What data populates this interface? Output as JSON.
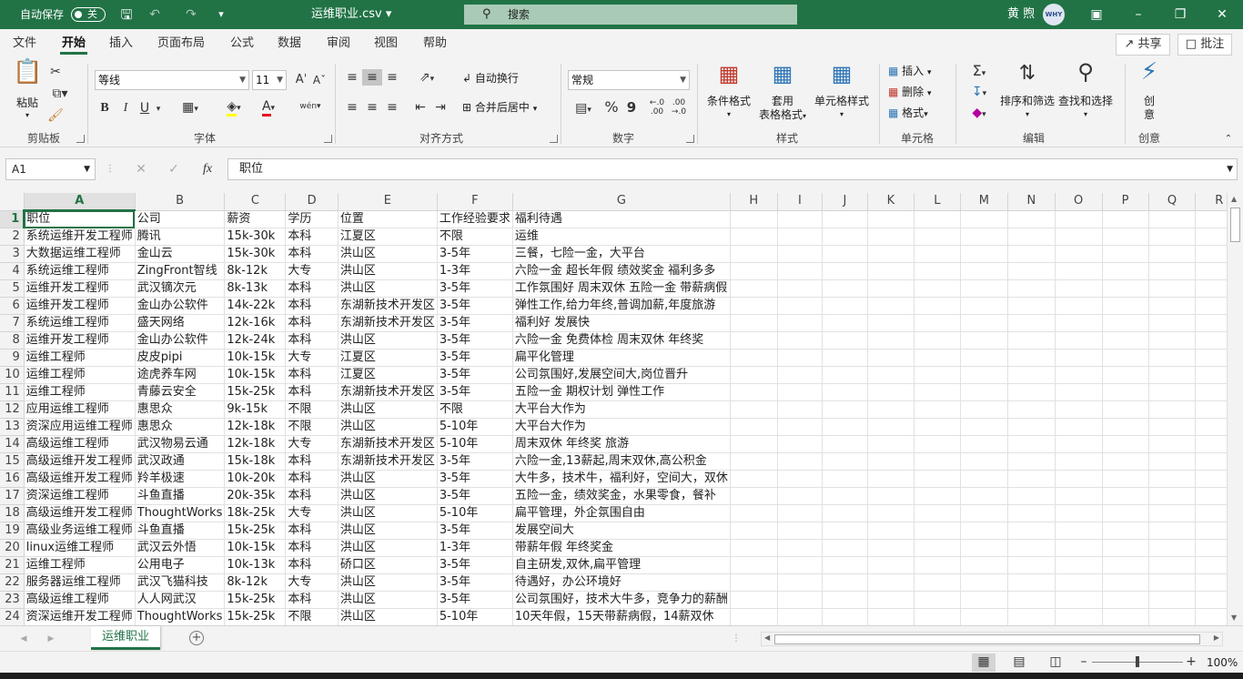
{
  "titlebar": {
    "autosave": "自动保存",
    "autosave_state": "关",
    "filename": "运维职业.csv",
    "search": "搜索",
    "user": "黄 煦",
    "avatar_text": "WHY"
  },
  "menu": {
    "tabs": [
      "文件",
      "开始",
      "插入",
      "页面布局",
      "公式",
      "数据",
      "审阅",
      "视图",
      "帮助"
    ],
    "share": "共享",
    "comment": "批注"
  },
  "ribbon": {
    "clipboard": {
      "label": "剪贴板",
      "paste": "粘贴"
    },
    "font": {
      "label": "字体",
      "name": "等线",
      "size": "11",
      "bold": "B",
      "italic": "I",
      "underline": "U",
      "phonetic": "wén"
    },
    "alignment": {
      "label": "对齐方式",
      "wrap": "自动换行",
      "merge": "合并后居中"
    },
    "number": {
      "label": "数字",
      "format": "常规",
      "percent": "%",
      "comma": "9"
    },
    "styles": {
      "label": "样式",
      "conditional": "条件格式",
      "table1": "套用",
      "table2": "表格格式",
      "cell": "单元格样式"
    },
    "cells": {
      "label": "单元格",
      "insert": "插入",
      "delete": "删除",
      "format": "格式"
    },
    "editing": {
      "label": "编辑",
      "sort": "排序和筛选",
      "find": "查找和选择"
    },
    "ideas": {
      "label": "创意",
      "btn1": "创",
      "btn2": "意"
    }
  },
  "formula": {
    "cell_ref": "A1",
    "content": "职位"
  },
  "columns": [
    "A",
    "B",
    "C",
    "D",
    "E",
    "F",
    "G",
    "H",
    "I",
    "J",
    "K",
    "L",
    "M",
    "N",
    "O",
    "P",
    "Q",
    "R"
  ],
  "rows": [
    [
      "职位",
      "公司",
      "薪资",
      "学历",
      "位置",
      "工作经验要求",
      "福利待遇"
    ],
    [
      "系统运维开发工程师",
      "腾讯",
      "15k-30k",
      "本科",
      "江夏区",
      "不限",
      "运维"
    ],
    [
      "大数据运维工程师",
      "金山云",
      "15k-30k",
      "本科",
      "洪山区",
      "3-5年",
      "三餐，七险一金，大平台"
    ],
    [
      "系统运维工程师",
      "ZingFront智线",
      "8k-12k",
      "大专",
      "洪山区",
      "1-3年",
      "六险一金 超长年假 绩效奖金 福利多多"
    ],
    [
      "运维开发工程师",
      "武汉镝次元",
      "8k-13k",
      "本科",
      "洪山区",
      "3-5年",
      "工作氛围好 周末双休 五险一金 带薪病假"
    ],
    [
      "运维开发工程师",
      "金山办公软件",
      "14k-22k",
      "本科",
      "东湖新技术开发区",
      "3-5年",
      "弹性工作,给力年终,普调加薪,年度旅游"
    ],
    [
      "系统运维工程师",
      "盛天网络",
      "12k-16k",
      "本科",
      "东湖新技术开发区",
      "3-5年",
      "福利好 发展快"
    ],
    [
      "运维开发工程师",
      "金山办公软件",
      "12k-24k",
      "本科",
      "洪山区",
      "3-5年",
      "六险一金 免费体检 周末双休 年终奖"
    ],
    [
      "运维工程师",
      "皮皮pipi",
      "10k-15k",
      "大专",
      "江夏区",
      "3-5年",
      "扁平化管理"
    ],
    [
      "运维工程师",
      "途虎养车网",
      "10k-15k",
      "本科",
      "江夏区",
      "3-5年",
      "公司氛围好,发展空间大,岗位晋升"
    ],
    [
      "运维工程师",
      "青藤云安全",
      "15k-25k",
      "本科",
      "东湖新技术开发区",
      "3-5年",
      "五险一金 期权计划 弹性工作"
    ],
    [
      "应用运维工程师",
      "惠思众",
      "9k-15k",
      "不限",
      "洪山区",
      "不限",
      "大平台大作为"
    ],
    [
      "资深应用运维工程师",
      "惠思众",
      "12k-18k",
      "不限",
      "洪山区",
      "5-10年",
      "大平台大作为"
    ],
    [
      "高级运维工程师",
      "武汉物易云通",
      "12k-18k",
      "大专",
      "东湖新技术开发区",
      "5-10年",
      "周末双休 年终奖 旅游"
    ],
    [
      "高级运维开发工程师",
      "武汉政通",
      "15k-18k",
      "本科",
      "东湖新技术开发区",
      "3-5年",
      "六险一金,13薪起,周末双休,高公积金"
    ],
    [
      "高级运维开发工程师",
      "羚羊极速",
      "10k-20k",
      "本科",
      "洪山区",
      "3-5年",
      "大牛多，技术牛，福利好，空间大，双休"
    ],
    [
      "资深运维工程师",
      "斗鱼直播",
      "20k-35k",
      "本科",
      "洪山区",
      "3-5年",
      "五险一金，绩效奖金，水果零食，餐补"
    ],
    [
      "高级运维开发工程师",
      "ThoughtWorks",
      "18k-25k",
      "大专",
      "洪山区",
      "5-10年",
      "扁平管理，外企氛围自由"
    ],
    [
      "高级业务运维工程师",
      "斗鱼直播",
      "15k-25k",
      "本科",
      "洪山区",
      "3-5年",
      "发展空间大"
    ],
    [
      "linux运维工程师",
      "武汉云外悟",
      "10k-15k",
      "本科",
      "洪山区",
      "1-3年",
      "带薪年假 年终奖金"
    ],
    [
      "运维工程师",
      "公用电子",
      "10k-13k",
      "本科",
      "硚口区",
      "3-5年",
      "自主研发,双休,扁平管理"
    ],
    [
      "服务器运维工程师",
      "武汉飞猫科技",
      "8k-12k",
      "大专",
      "洪山区",
      "3-5年",
      "待遇好，办公环境好"
    ],
    [
      "高级运维工程师",
      "人人网武汉",
      "15k-25k",
      "本科",
      "洪山区",
      "3-5年",
      "公司氛围好，技术大牛多，竞争力的薪酬"
    ],
    [
      "资深运维开发工程师",
      "ThoughtWorks",
      "15k-25k",
      "不限",
      "洪山区",
      "5-10年",
      "10天年假，15天带薪病假，14薪双休"
    ]
  ],
  "sheet_tab": "运维职业",
  "status": {
    "zoom": "100%"
  }
}
